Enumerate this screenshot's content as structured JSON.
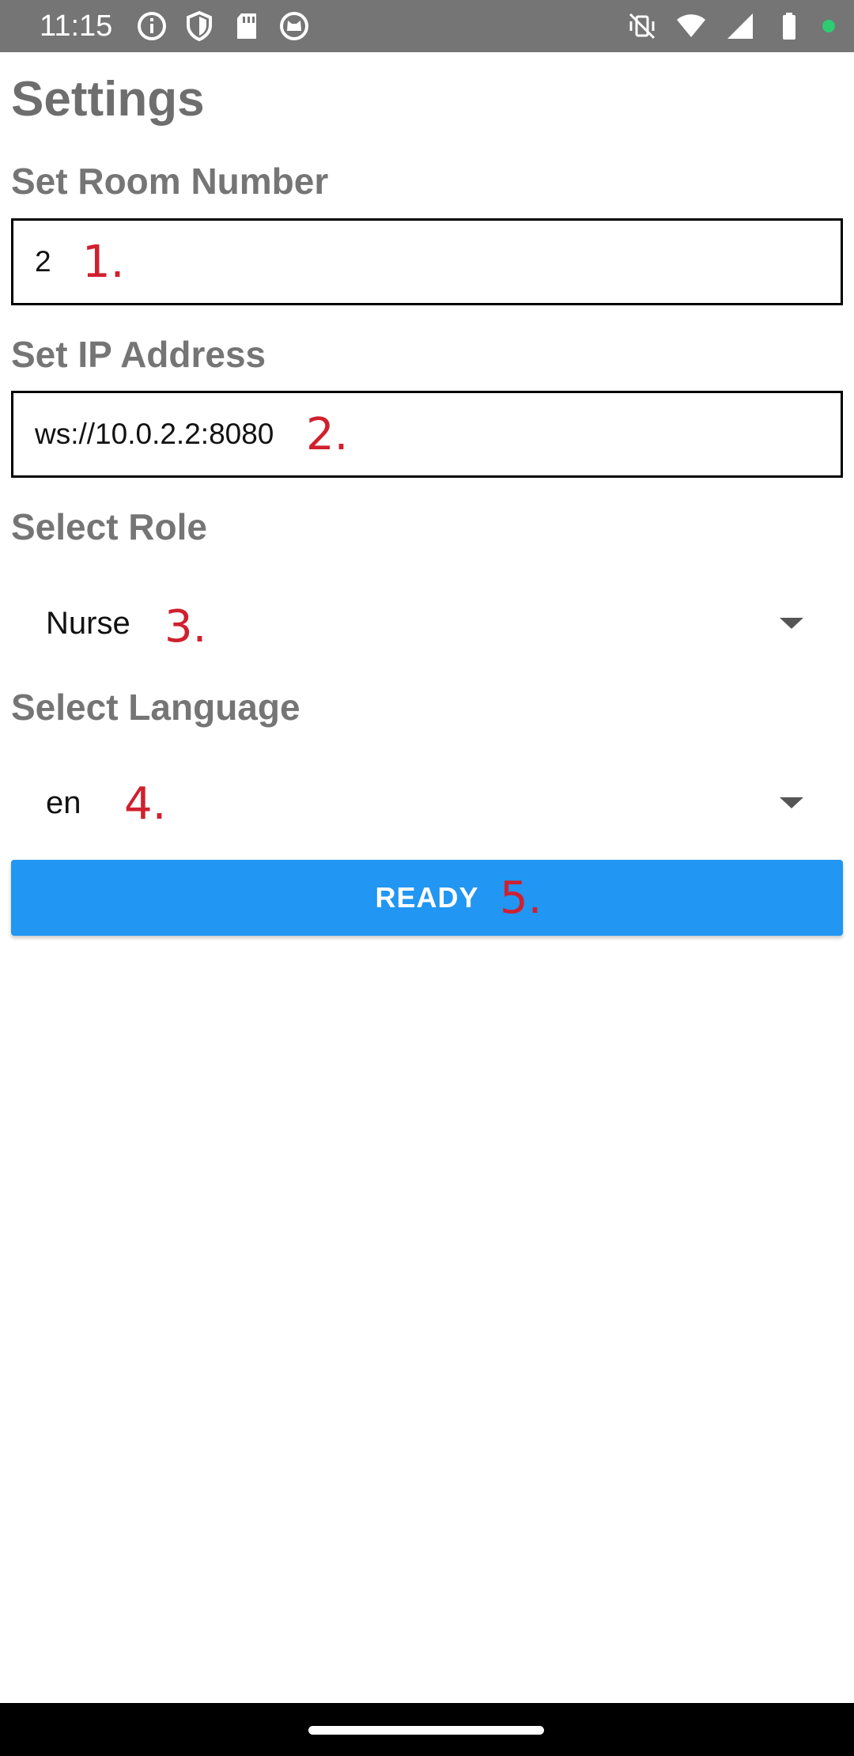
{
  "status_bar": {
    "time": "11:15",
    "left_icons": [
      "info-icon",
      "shield-icon",
      "sd-card-icon",
      "cat-icon"
    ],
    "right_icons": [
      "vibrate-off-icon",
      "wifi-icon",
      "signal-icon",
      "battery-icon",
      "camera-dot-icon"
    ],
    "dot_color": "#2ecc71"
  },
  "page": {
    "title": "Settings"
  },
  "room_number": {
    "label": "Set Room Number",
    "value": "2",
    "marker": "1."
  },
  "ip_address": {
    "label": "Set IP Address",
    "value": "ws://10.0.2.2:8080",
    "marker": "2."
  },
  "role": {
    "label": "Select Role",
    "selected": "Nurse",
    "marker": "3."
  },
  "language": {
    "label": "Select Language",
    "selected": "en",
    "marker": "4."
  },
  "ready_button": {
    "label": "READY",
    "marker": "5."
  },
  "colors": {
    "primary": "#2196f3",
    "marker": "#d0202e",
    "status_bar": "#757575"
  }
}
